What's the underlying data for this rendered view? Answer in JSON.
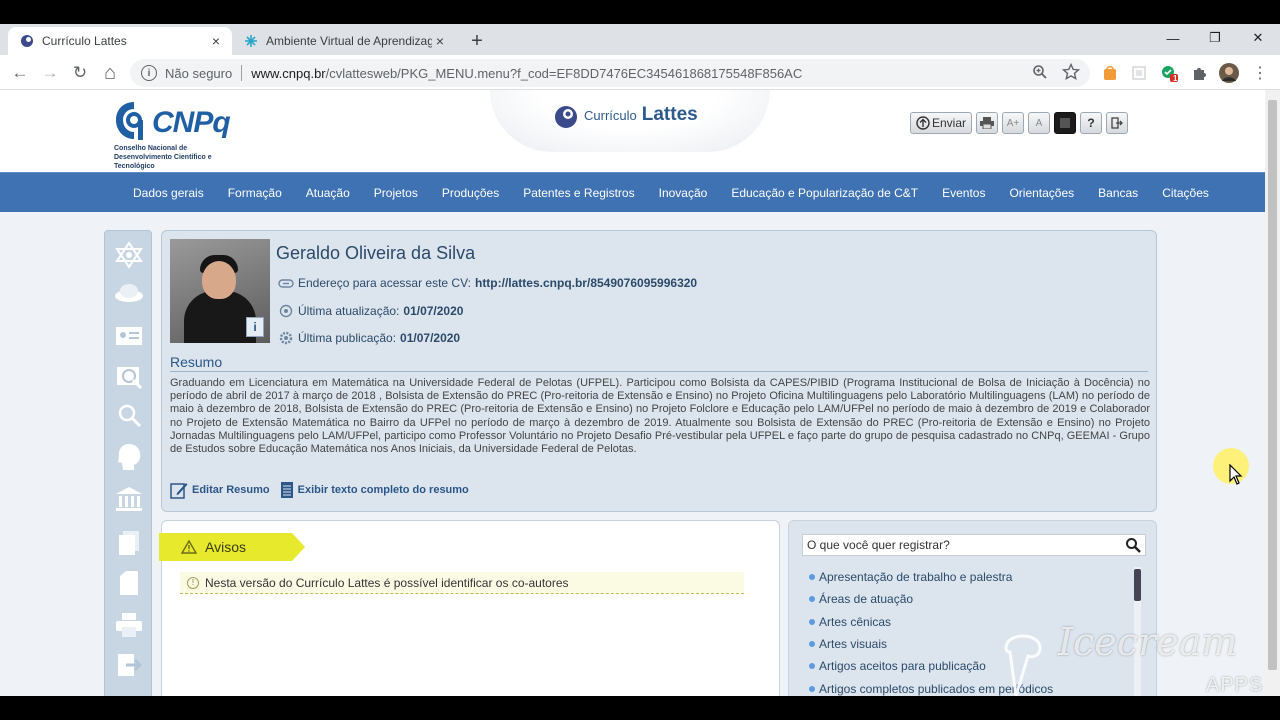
{
  "browser": {
    "tabs": [
      {
        "title": "Currículo Lattes",
        "close": "×",
        "active": true
      },
      {
        "title": "Ambiente Virtual de Aprendizage",
        "close": "×",
        "active": false
      }
    ],
    "new_tab": "+",
    "window_controls": {
      "minimize": "—",
      "maximize": "❐",
      "close": "✕"
    },
    "nav_icons": {
      "back": "←",
      "forward": "→",
      "reload": "↻",
      "home": "⌂"
    },
    "address": {
      "security_label": "Não seguro",
      "host": "www.cnpq.br",
      "path": "/cvlattesweb/PKG_MENU.menu?f_cod=EF8DD7476EC345461868175548F856AC"
    },
    "extension_badge": "1"
  },
  "header": {
    "cnpq_word": "CNPq",
    "cnpq_sub": "Conselho Nacional de Desenvolvimento Científico e Tecnológico",
    "lattes_prefix": "Currículo",
    "lattes_word": "Lattes",
    "tools": {
      "send": "Enviar",
      "font_up": "A+",
      "font_reset": "A",
      "help": "?"
    }
  },
  "nav": {
    "items": [
      "Dados gerais",
      "Formação",
      "Atuação",
      "Projetos",
      "Produções",
      "Patentes e Registros",
      "Inovação",
      "Educação e Popularização de C&T",
      "Eventos",
      "Orientações",
      "Bancas",
      "Citações"
    ]
  },
  "profile": {
    "name": "Geraldo Oliveira da Silva",
    "cv_label": "Endereço para acessar este CV:",
    "cv_url": "http://lattes.cnpq.br/8549076095996320",
    "updated_label": "Última atualização:",
    "updated_date": "01/07/2020",
    "published_label": "Última publicação:",
    "published_date": "01/07/2020",
    "summary_heading": "Resumo",
    "summary": "Graduando em Licenciatura em Matemática na Universidade Federal de Pelotas (UFPEL). Participou como Bolsista da CAPES/PIBID (Programa Institucional de Bolsa de Iniciação à Docência) no período de abril de 2017 à março de 2018 , Bolsista de Extensão do PREC (Pro-reitoria de Extensão e Ensino) no Projeto Oficina Multilinguagens pelo Laboratório Multilinguagens (LAM) no período de maio à dezembro de 2018, Bolsista de Extensão do PREC (Pro-reitoria de Extensão e Ensino) no Projeto Folclore e Educação pelo LAM/UFPel no período de maio à dezembro de 2019 e Colaborador no Projeto de Extensão Matemática no Bairro da UFPel no período de março à dezembro de 2019. Atualmente sou Bolsista de Extensão do PREC (Pro-reitoria de Extensão e Ensino) no Projeto Jornadas Multilinguagens pelo LAM/UFPel, participo como Professor Voluntário no Projeto Desafio Pré-vestibular pela UFPEL e faço parte do grupo de pesquisa cadastrado no CNPq, GEEMAI - Grupo de Estudos sobre Educação Matemática nos Anos Iniciais, da Universidade Federal de Pelotas.",
    "edit_summary": "Editar Resumo",
    "full_summary": "Exibir texto completo do resumo"
  },
  "avisos": {
    "title": "Avisos",
    "message": "Nesta versão do Currículo Lattes é possível identificar os co-autores"
  },
  "registrar": {
    "placeholder": "O que você quer registrar?",
    "items": [
      "Apresentação de trabalho e palestra",
      "Áreas de atuação",
      "Artes cênicas",
      "Artes visuais",
      "Artigos aceitos para publicação",
      "Artigos completos publicados em periódicos"
    ]
  },
  "watermark": {
    "line1": "Icecream",
    "line2": "APPS"
  },
  "colors": {
    "nav_bg": "#3e72b3",
    "brand_blue": "#1f5fa4",
    "avisos_tag": "#e6e92c",
    "page_bg": "#eff3f7"
  }
}
